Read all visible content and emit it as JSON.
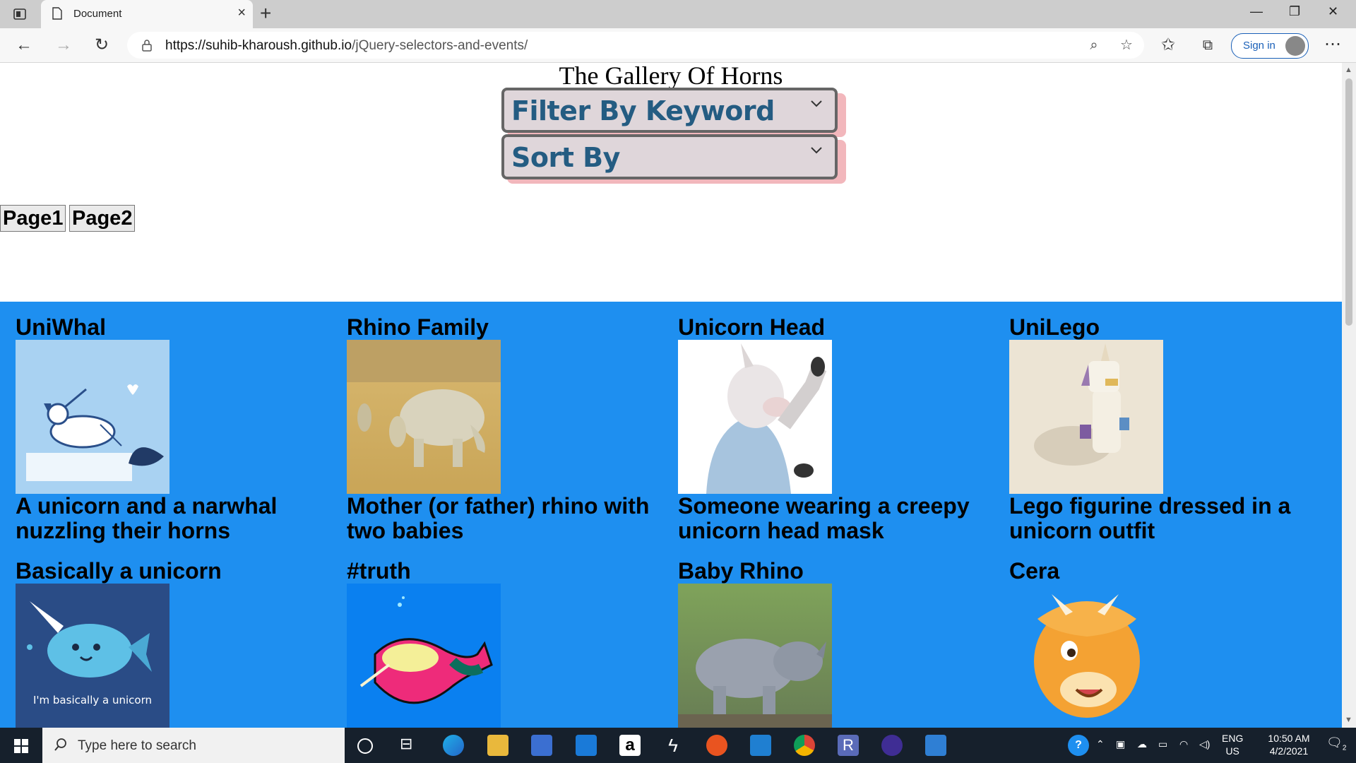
{
  "browser": {
    "tab_title": "Document",
    "url_host": "https://suhib-kharoush.github.io",
    "url_path": "/jQuery-selectors-and-events/",
    "signin_label": "Sign in"
  },
  "page": {
    "title": "The Gallery Of Horns",
    "filter_label": "Filter By Keyword",
    "sort_label": "Sort By",
    "page_buttons": [
      "Page1",
      "Page2"
    ],
    "gallery_bg": "#1e8ff0"
  },
  "cards": [
    {
      "title": "UniWhal",
      "description": "A unicorn and a narwhal nuzzling their horns",
      "image": "unicorn-narwhal-illustration"
    },
    {
      "title": "Rhino Family",
      "description": "Mother (or father) rhino with two babies",
      "image": "rhino-family-photo"
    },
    {
      "title": "Unicorn Head",
      "description": "Someone wearing a creepy unicorn head mask",
      "image": "unicorn-mask-photo"
    },
    {
      "title": "UniLego",
      "description": "Lego figurine dressed in a unicorn outfit",
      "image": "lego-unicorn-photo"
    },
    {
      "title": "Basically a unicorn",
      "description": "",
      "image": "narwhal-cartoon",
      "image_caption": "I'm basically a unicorn"
    },
    {
      "title": "#truth",
      "description": "",
      "image": "narwhal-drawing"
    },
    {
      "title": "Baby Rhino",
      "description": "",
      "image": "baby-rhino-photo"
    },
    {
      "title": "Cera",
      "description": "",
      "image": "triceratops-cartoon"
    }
  ],
  "taskbar": {
    "search_placeholder": "Type here to search",
    "lang_top": "ENG",
    "lang_bottom": "US",
    "time": "10:50 AM",
    "date": "4/2/2021",
    "notification_count": "2"
  }
}
